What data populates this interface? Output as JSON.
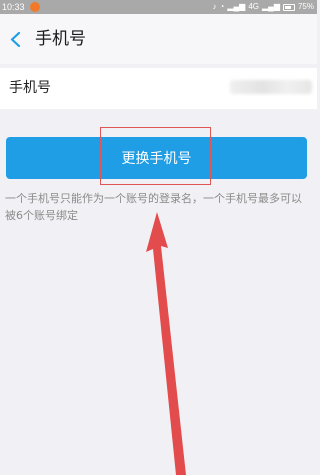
{
  "status_bar": {
    "time": "10:33",
    "network_label": "4G",
    "battery_percent": "75%",
    "icons": [
      "mute-icon",
      "wifi-icon",
      "signal-icon",
      "battery-icon"
    ]
  },
  "header": {
    "title": "手机号",
    "back_icon": "chevron-left-icon"
  },
  "phone_row": {
    "label": "手机号"
  },
  "change_button": {
    "label": "更换手机号"
  },
  "note": "一个手机号只能作为一个账号的登录名，一个手机号最多可以被6个账号绑定",
  "colors": {
    "accent": "#1f9ee6",
    "back_icon": "#1f9ee6",
    "annotation": "#e03a3a",
    "background": "#f1f1f5"
  }
}
